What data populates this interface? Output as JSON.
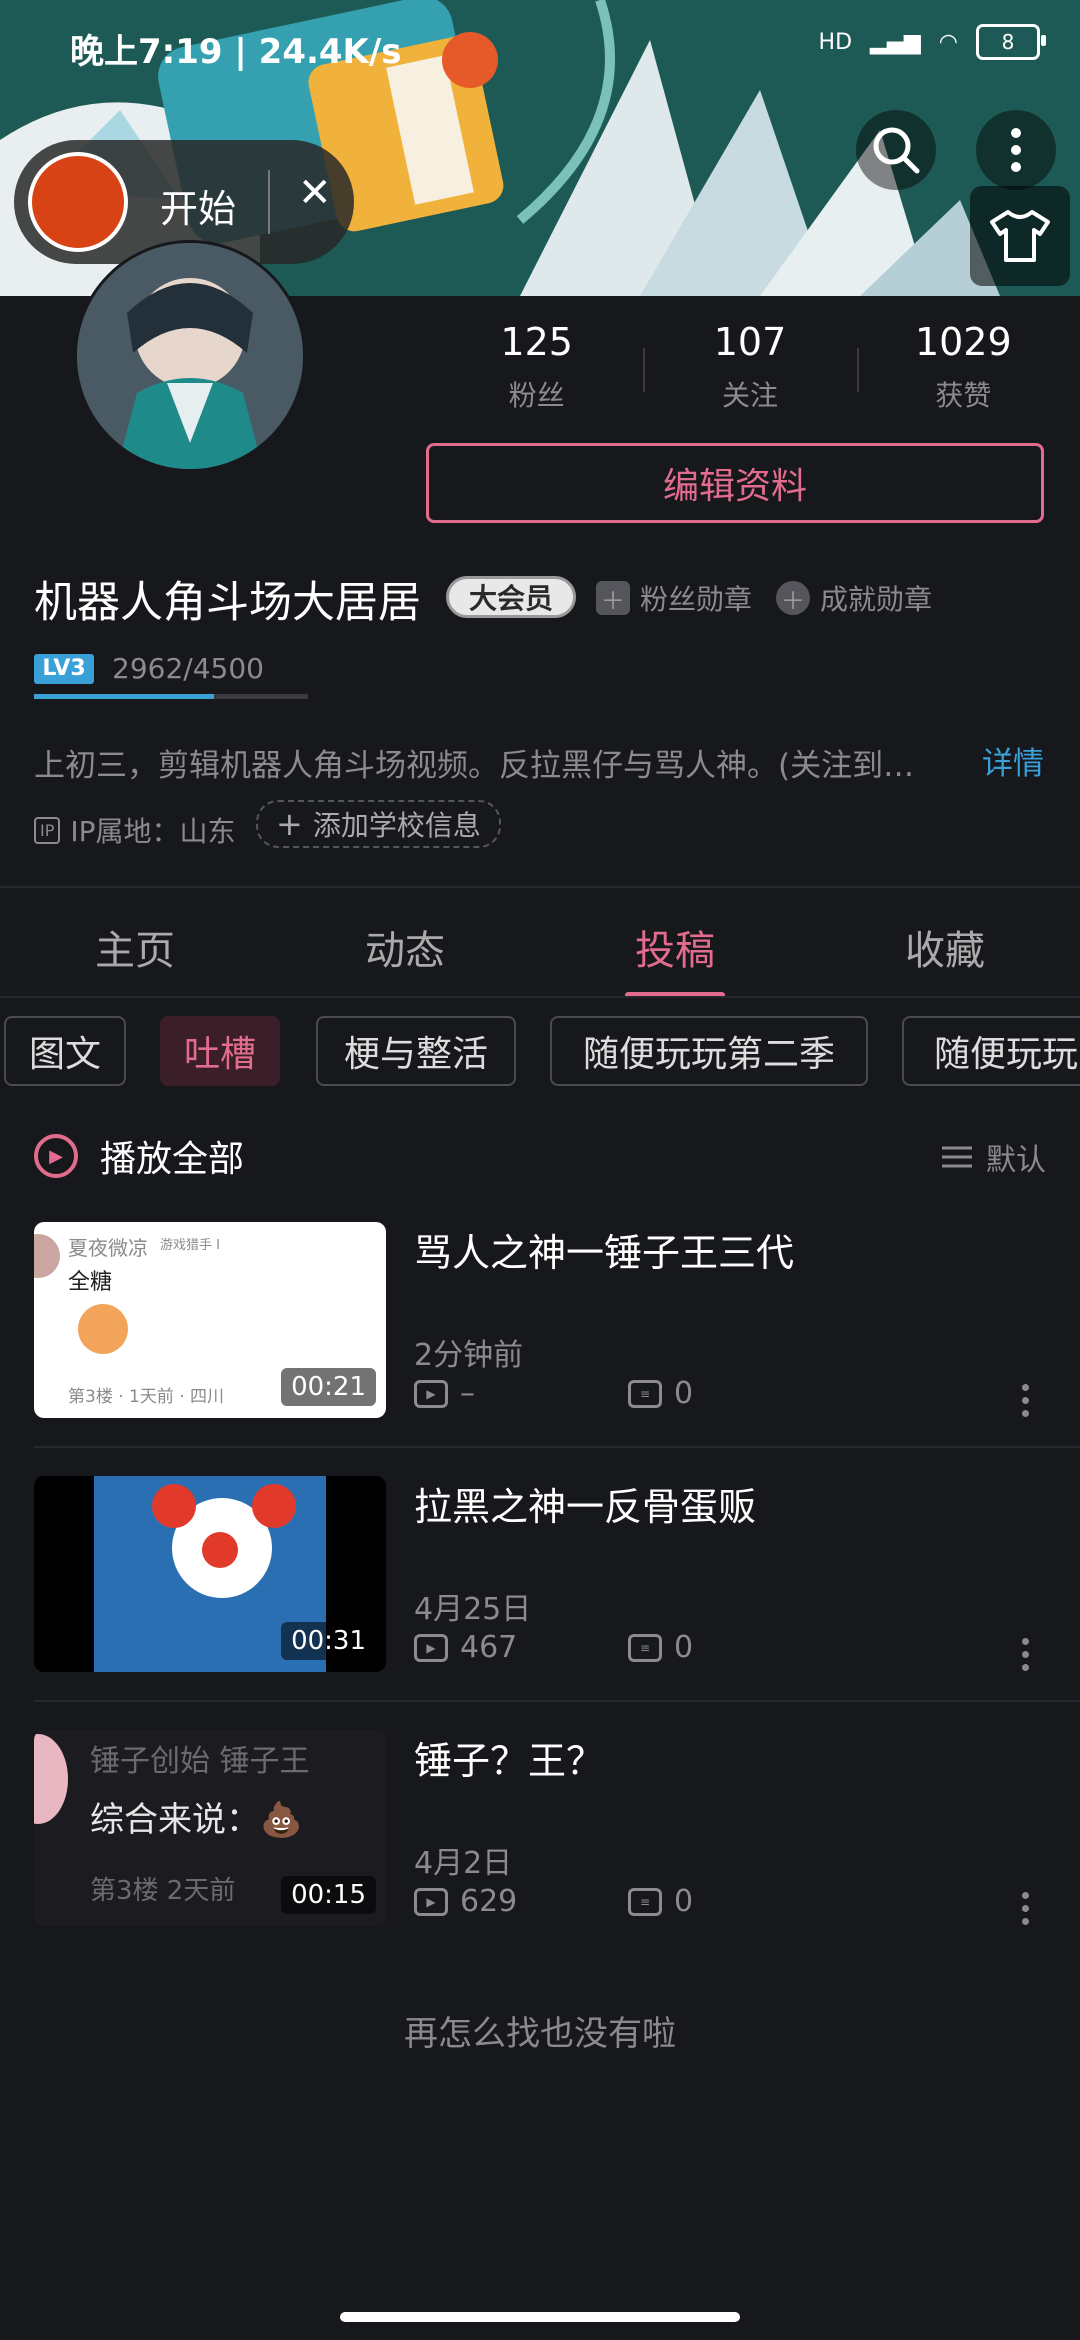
{
  "status_bar": {
    "time": "晚上7:19 | 24.4K/s",
    "signal": "HD",
    "battery": "8"
  },
  "recording": {
    "label": "开始",
    "close": "✕"
  },
  "profile": {
    "stats": [
      {
        "num": "125",
        "label": "粉丝"
      },
      {
        "num": "107",
        "label": "关注"
      },
      {
        "num": "1029",
        "label": "获赞"
      }
    ],
    "edit_button": "编辑资料",
    "username": "机器人角斗场大居居",
    "vip_badge": "大会员",
    "fan_medal": "粉丝勋章",
    "achievement_medal": "成就勋章",
    "level_badge": "LV3",
    "exp": "2962/4500",
    "exp_fraction": 0.658,
    "bio": "上初三，剪辑机器人角斗场视频。反拉黑仔与骂人神。(关注到…",
    "bio_more": "详情",
    "ip_tag": "IP",
    "ip_location": "IP属地：山东",
    "add_school": "添加学校信息"
  },
  "tabs": [
    {
      "label": "主页"
    },
    {
      "label": "动态"
    },
    {
      "label": "投稿"
    },
    {
      "label": "收藏"
    }
  ],
  "chips": [
    {
      "label": "图文"
    },
    {
      "label": "吐槽"
    },
    {
      "label": "梗与整活"
    },
    {
      "label": "随便玩玩第二季"
    },
    {
      "label": "随便玩玩"
    }
  ],
  "play_all": "播放全部",
  "sort_label": "默认",
  "videos": [
    {
      "title": "骂人之神一锤子王三代",
      "date": "2分钟前",
      "views": "–",
      "comments": "0",
      "duration": "00:21",
      "thumb_user": "夏夜微凉",
      "thumb_tag": "游戏猎手 I",
      "thumb_text": "全糖",
      "thumb_meta": "第3楼 · 1天前 · 四川"
    },
    {
      "title": "拉黑之神一反骨蛋贩",
      "date": "4月25日",
      "views": "467",
      "comments": "0",
      "duration": "00:31"
    },
    {
      "title": "锤子？王？",
      "date": "4月2日",
      "views": "629",
      "comments": "0",
      "duration": "00:15",
      "thumb_user": "锤子创始 锤子王",
      "thumb_text": "综合来说：💩",
      "thumb_meta": "第3楼  2天前"
    }
  ],
  "end_message": "再怎么找也没有啦"
}
